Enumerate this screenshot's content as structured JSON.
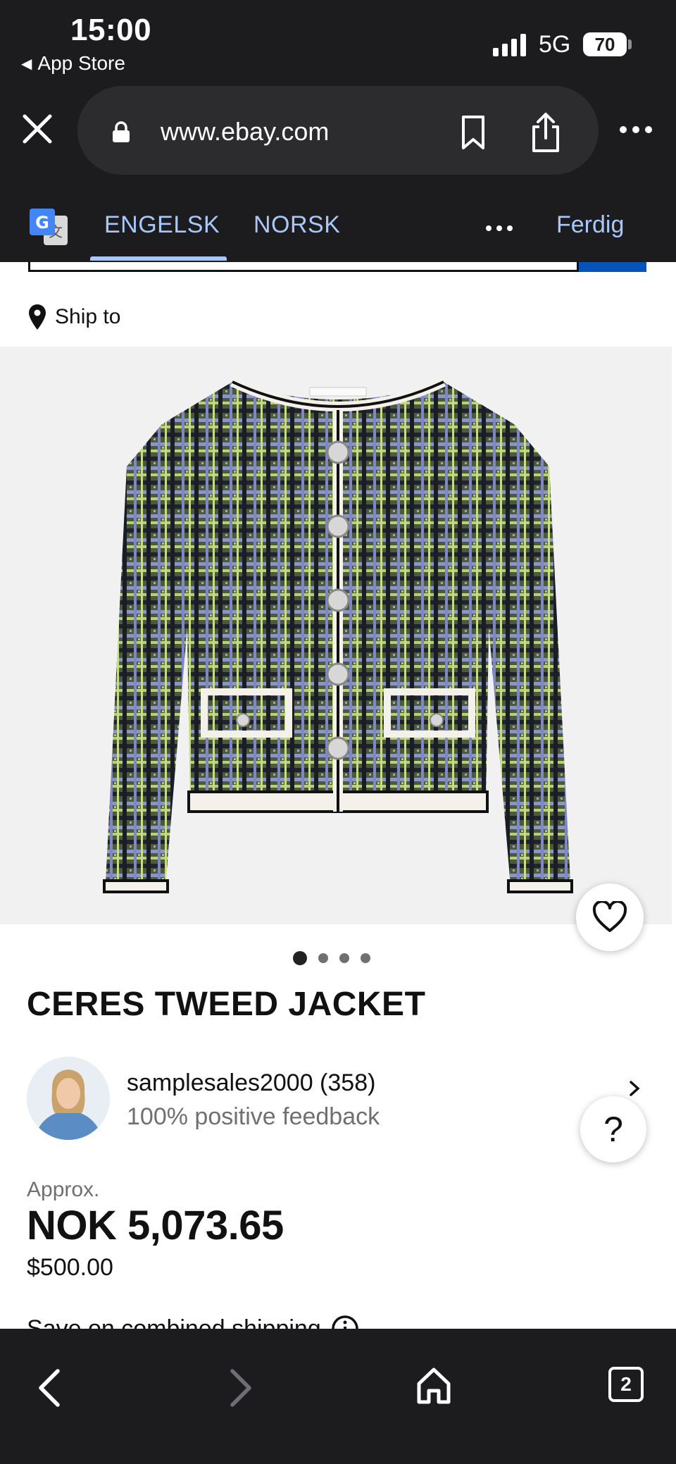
{
  "status_bar": {
    "time": "15:00",
    "back_app": "App Store",
    "network": "5G",
    "battery": "70"
  },
  "browser": {
    "url": "www.ebay.com",
    "open_tabs": "2"
  },
  "translate_bar": {
    "source_lang": "ENGELSK",
    "target_lang": "NORSK",
    "done_label": "Ferdig",
    "accent_color": "#a8c7fa"
  },
  "page": {
    "ship_to": "Ship to",
    "image_pages": 4,
    "image_page_active": 1,
    "title": "CERES TWEED JACKET",
    "seller": {
      "name": "samplesales2000 (358)",
      "feedback": "100% positive feedback"
    },
    "price": {
      "approx_label": "Approx.",
      "local": "NOK 5,073.65",
      "usd": "$500.00"
    },
    "combined_shipping": "Save on combined shipping",
    "help_label": "?"
  },
  "icons": [
    "close-icon",
    "lock-icon",
    "bookmark-icon",
    "share-icon",
    "more-icon",
    "google-translate-icon",
    "location-pin-icon",
    "heart-icon",
    "chevron-right-icon",
    "info-icon",
    "back-icon",
    "forward-icon",
    "home-icon",
    "tabs-icon"
  ]
}
